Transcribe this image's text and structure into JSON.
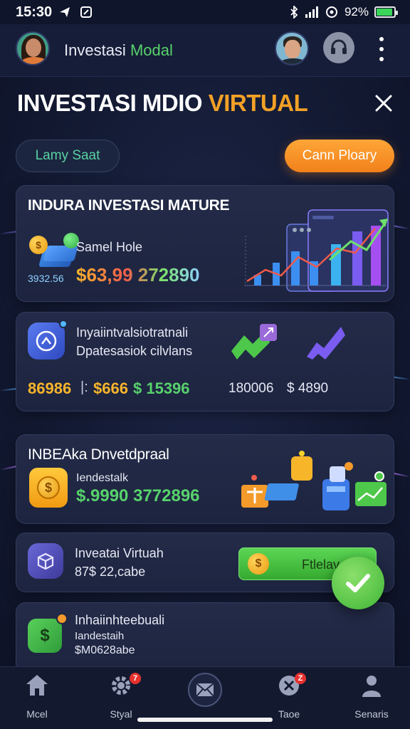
{
  "status_bar": {
    "time": "15:30",
    "battery_text": "92%",
    "battery_level": 0.92
  },
  "header": {
    "title_part1": "Investasi",
    "title_part2": "Modal"
  },
  "page": {
    "title_part1": "INVESTASI MDIO",
    "title_part2": "VIRTUAL"
  },
  "actions": {
    "balance_pill": "Lamy Saat",
    "cta_button": "Cann Ploary"
  },
  "card_market": {
    "heading": "INDURA INVESTASI MATURE",
    "label": "Samel Hole",
    "small_value": "3932.56",
    "value": "$63,99 272890"
  },
  "card_portfolio": {
    "title": "Inyaiintvalsiotratnali",
    "subtitle": "Dpatesasiok cilvlans",
    "stat_left_1": "86986",
    "stat_left_2": "$666",
    "stat_left_3": "$ 15396",
    "stat_right_1": "180006",
    "stat_right_2": "$ 4890"
  },
  "card_deposit": {
    "heading": "INBEAka Dnvetdpraal",
    "label": "Iendestalk",
    "value": "$.9990 3772896"
  },
  "card_virtual": {
    "title": "Inveatai Virtuah",
    "sub": "87$ 22,cabe",
    "button": "Ftlelav"
  },
  "card_bottom": {
    "title": "Inhaiinhteebuali",
    "label": "Iandestaih",
    "value": "$M0628abe"
  },
  "nav": {
    "items": [
      {
        "label": "Mcel",
        "icon": "home-icon"
      },
      {
        "label": "Styal",
        "icon": "gear-icon",
        "badge": "7"
      },
      {
        "label": "",
        "icon": "mail-icon"
      },
      {
        "label": "Taoe",
        "icon": "tag-icon",
        "badge": "Z"
      },
      {
        "label": "Senaris",
        "icon": "person-icon"
      }
    ]
  },
  "colors": {
    "background": "#131a33",
    "accent_green": "#57d26b",
    "accent_orange": "#f2a126",
    "card": "#232b48"
  }
}
